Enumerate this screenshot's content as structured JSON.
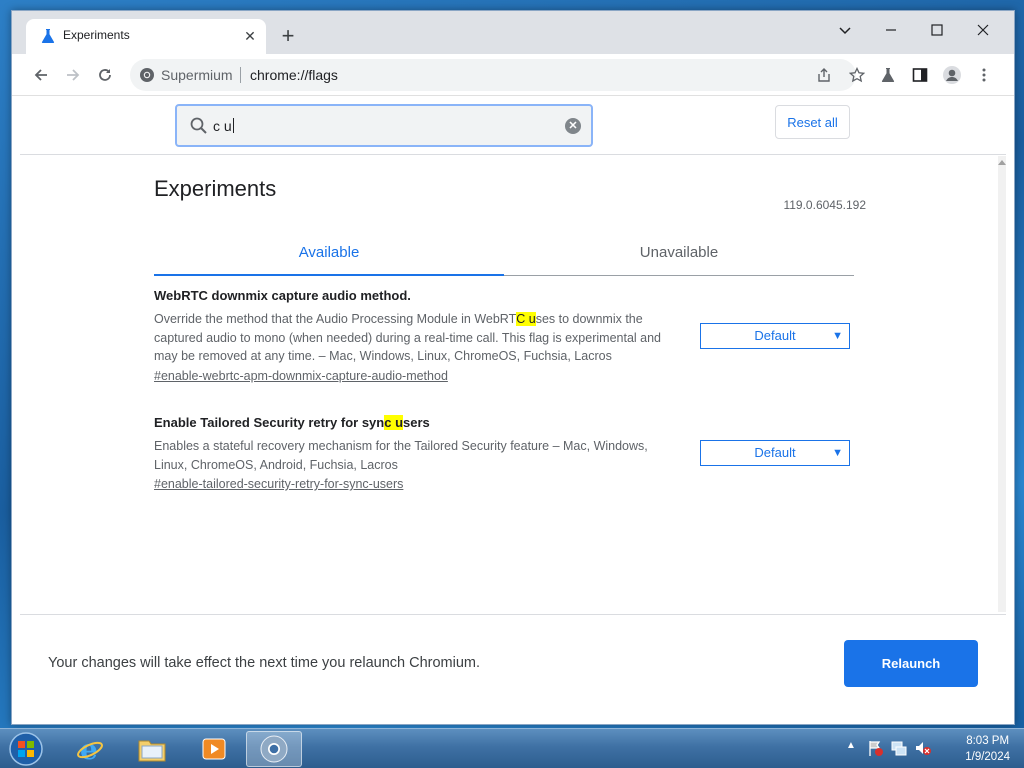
{
  "browser": {
    "tab_title": "Experiments",
    "omnibox_site": "Supermium",
    "omnibox_url": "chrome://flags"
  },
  "flags_page": {
    "search_value": "c u",
    "reset_all_label": "Reset all",
    "title": "Experiments",
    "version": "119.0.6045.192",
    "tab_available": "Available",
    "tab_unavailable": "Unavailable",
    "flags": [
      {
        "title": "WebRTC downmix capture audio method.",
        "desc_before": "Override the method that the Audio Processing Module in WebRT",
        "desc_highlight": "C u",
        "desc_after": "ses to downmix the captured audio to mono (when needed) during a real-time call. This flag is experimental and may be removed at any time. – Mac, Windows, Linux, ChromeOS, Fuchsia, Lacros",
        "link": "#enable-webrtc-apm-downmix-capture-audio-method",
        "select_value": "Default"
      },
      {
        "title_before": "Enable Tailored Security retry for syn",
        "title_highlight": "c u",
        "title_after": "sers",
        "desc": "Enables a stateful recovery mechanism for the Tailored Security feature – Mac, Windows, Linux, ChromeOS, Android, Fuchsia, Lacros",
        "link": "#enable-tailored-security-retry-for-sync-users",
        "select_value": "Default"
      }
    ],
    "footer_message": "Your changes will take effect the next time you relaunch Chromium.",
    "relaunch_label": "Relaunch"
  },
  "taskbar": {
    "time": "8:03 PM",
    "date": "1/9/2024",
    "items": [
      "internet-explorer-icon",
      "file-explorer-icon",
      "media-player-icon",
      "chromium-icon"
    ]
  },
  "colors": {
    "accent": "#1a73e8",
    "highlight": "#ffff00",
    "tabstrip": "#dee1e6"
  }
}
